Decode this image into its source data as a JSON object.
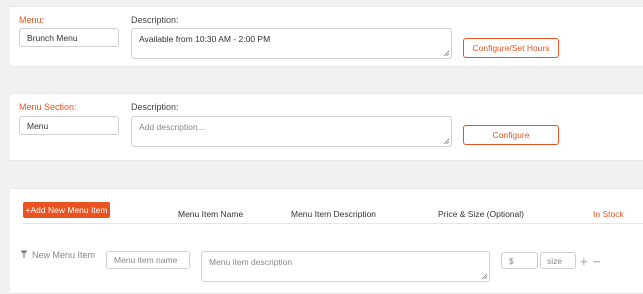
{
  "menu": {
    "label": "Menu:",
    "name_value": "Brunch Menu",
    "description_label": "Description:",
    "description_value": "Available from 10:30 AM - 2:00 PM",
    "configure_button": "Configure/Set Hours"
  },
  "section": {
    "label": "Menu Section:",
    "name_value": "Menu",
    "description_label": "Description:",
    "description_placeholder": "Add description...",
    "configure_button": "Configure"
  },
  "items": {
    "add_button": "+Add New Menu Item",
    "columns": {
      "name": "Menu Item Name",
      "description": "Menu Item Description",
      "price_size": "Price & Size (Optional)",
      "in_stock": "In Stock"
    },
    "new_row": {
      "label": "New Menu Item",
      "name_placeholder": "Menu item name",
      "description_placeholder": "Menu item description",
      "price_placeholder": "$",
      "size_placeholder": "size"
    }
  },
  "colors": {
    "accent": "#e8531f",
    "background": "#f1f1f1",
    "card": "#ffffff"
  }
}
